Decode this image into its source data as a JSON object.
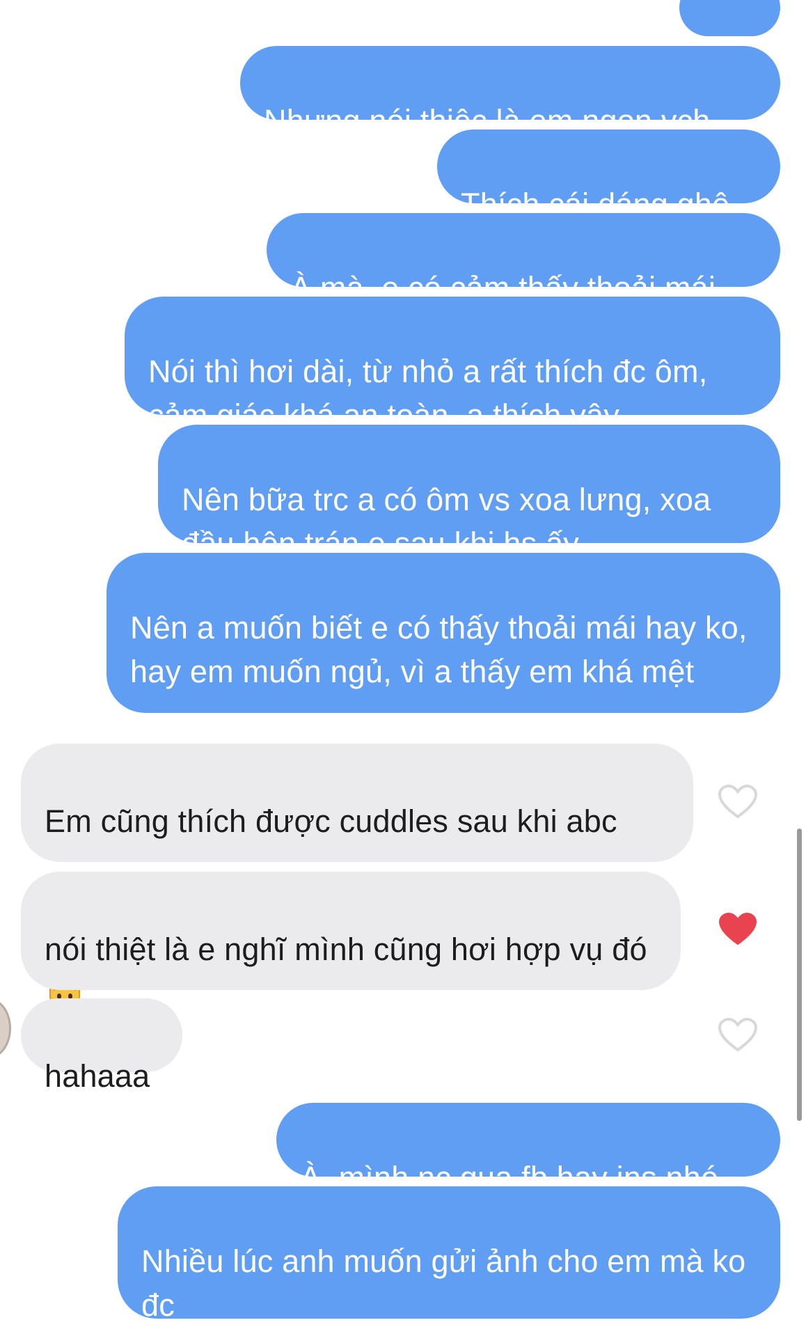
{
  "colors": {
    "outgoing_bubble": "#5f9ef2",
    "incoming_bubble": "#ebebee",
    "liked_heart": "#e8434f",
    "unliked_heart": "#d8d8dc"
  },
  "messages": [
    {
      "from": "me",
      "text": ":)))))"
    },
    {
      "from": "me",
      "text": "Nhưng nói thiệc là em ngon vch"
    },
    {
      "from": "me",
      "text": "Thích cái dáng ghê"
    },
    {
      "from": "me",
      "text": "À mà, e có cảm thấy thoải mái"
    },
    {
      "from": "me",
      "text": "Nói thì hơi dài, từ nhỏ a rất thích đc ôm, cảm giác khá an toàn, a thích vậy"
    },
    {
      "from": "me",
      "text": "Nên bữa trc a có ôm vs xoa lưng, xoa đầu hôn trán e sau khi hs ấy"
    },
    {
      "from": "me",
      "text": "Nên a muốn biết e có thấy thoải mái hay ko, hay em muốn ngủ, vì a thấy em khá mệt"
    },
    {
      "from": "them",
      "text": "Em cũng thích được cuddles sau khi abc",
      "emoji": "cat-face-icon",
      "liked": false
    },
    {
      "from": "them",
      "text": "nói thiệt là e nghĩ mình cũng hơi hợp vụ đó",
      "emoji": "baby-chick-icon",
      "liked": true
    },
    {
      "from": "them",
      "text": "hahaaa",
      "liked": false
    },
    {
      "from": "me",
      "text": "À, mình nc qua fb hay ins nhé"
    },
    {
      "from": "me",
      "text": "Nhiều lúc anh muốn gửi ảnh cho em mà ko đc"
    }
  ]
}
